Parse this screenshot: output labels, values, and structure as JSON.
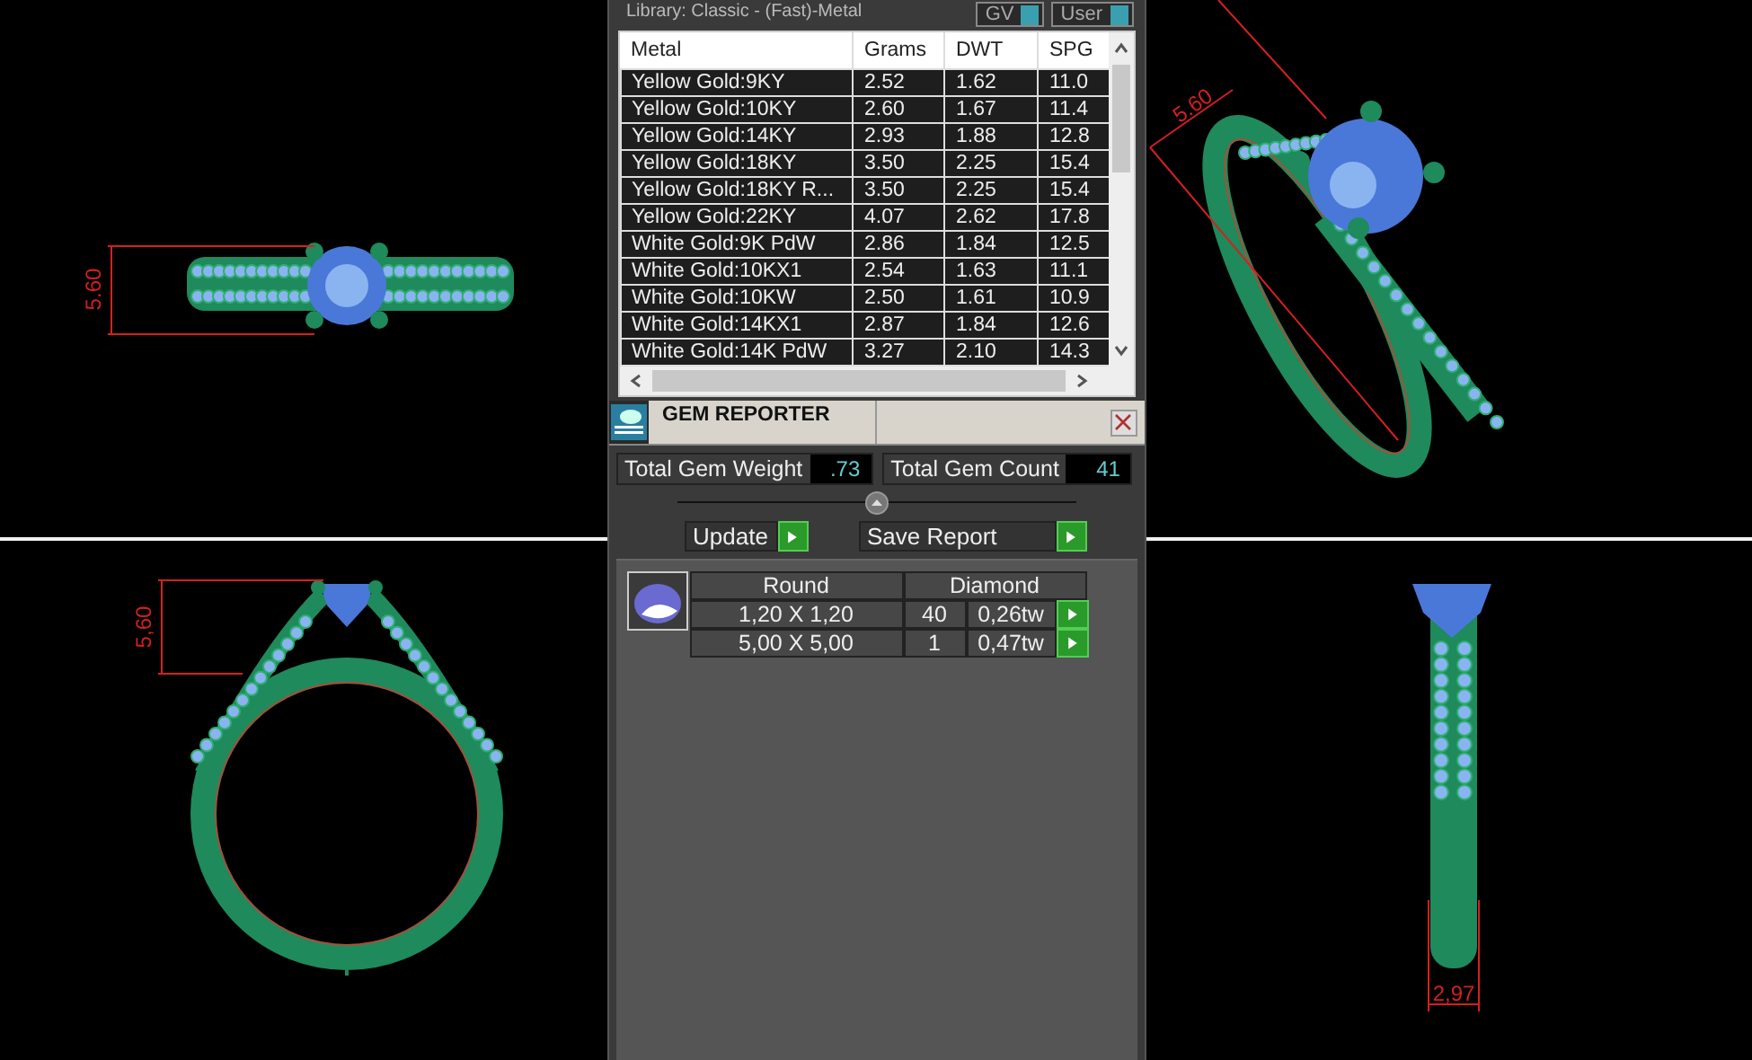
{
  "viewports": [
    {
      "kind": "top",
      "dimension": "5.60"
    },
    {
      "kind": "front",
      "dimension": "5,60"
    },
    {
      "kind": "perspective",
      "dimension": "5.60"
    },
    {
      "kind": "side",
      "dimension": "2,97"
    }
  ],
  "library_label": "Library: Classic - (Fast)-Metal",
  "toggles": [
    "GV",
    "User"
  ],
  "metal_table": {
    "columns": [
      "Metal",
      "Grams",
      "DWT",
      "SPG"
    ],
    "rows": [
      [
        "Yellow Gold:9KY",
        "2.52",
        "1.62",
        "11.0"
      ],
      [
        "Yellow Gold:10KY",
        "2.60",
        "1.67",
        "11.4"
      ],
      [
        "Yellow Gold:14KY",
        "2.93",
        "1.88",
        "12.8"
      ],
      [
        "Yellow Gold:18KY",
        "3.50",
        "2.25",
        "15.4"
      ],
      [
        "Yellow Gold:18KY R...",
        "3.50",
        "2.25",
        "15.4"
      ],
      [
        "Yellow Gold:22KY",
        "4.07",
        "2.62",
        "17.8"
      ],
      [
        "White Gold:9K PdW",
        "2.86",
        "1.84",
        "12.5"
      ],
      [
        "White Gold:10KX1",
        "2.54",
        "1.63",
        "11.1"
      ],
      [
        "White Gold:10KW",
        "2.50",
        "1.61",
        "10.9"
      ],
      [
        "White Gold:14KX1",
        "2.87",
        "1.84",
        "12.6"
      ],
      [
        "White Gold:14K PdW",
        "3.27",
        "2.10",
        "14.3"
      ]
    ]
  },
  "gem_reporter": {
    "title": "GEM REPORTER",
    "fields": [
      {
        "label": "Total Gem Weight",
        "value": ".73"
      },
      {
        "label": "Total Gem Count",
        "value": "41"
      }
    ],
    "buttons": [
      "Update",
      "Save Report"
    ],
    "gem_table": {
      "columns": [
        "Round",
        "Diamond"
      ],
      "rows": [
        {
          "size": "1,20 X 1,20",
          "count": "40",
          "weight": "0,26tw"
        },
        {
          "size": "5,00 X 5,00",
          "count": "1",
          "weight": "0,47tw"
        }
      ]
    }
  }
}
